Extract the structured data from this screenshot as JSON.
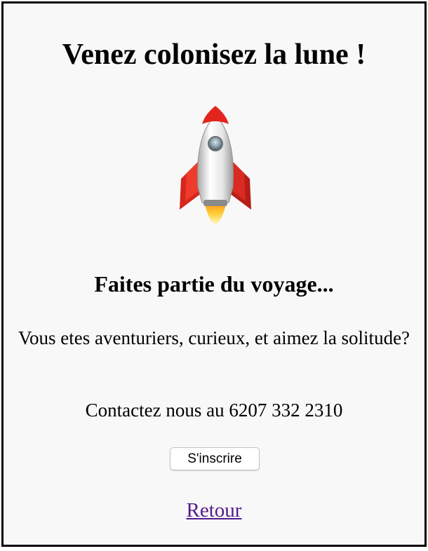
{
  "page": {
    "title": "Venez colonisez la lune !",
    "subtitle": "Faites partie du voyage...",
    "description": "Vous etes aventuriers, curieux, et aimez la solitude?",
    "contact": "Contactez nous au 6207 332 2310",
    "signup_label": "S'inscrire",
    "back_link": "Retour",
    "image_icon": "rocket-icon"
  },
  "colors": {
    "link": "#551a8b",
    "background": "#f8f8f8",
    "border": "#000000"
  }
}
